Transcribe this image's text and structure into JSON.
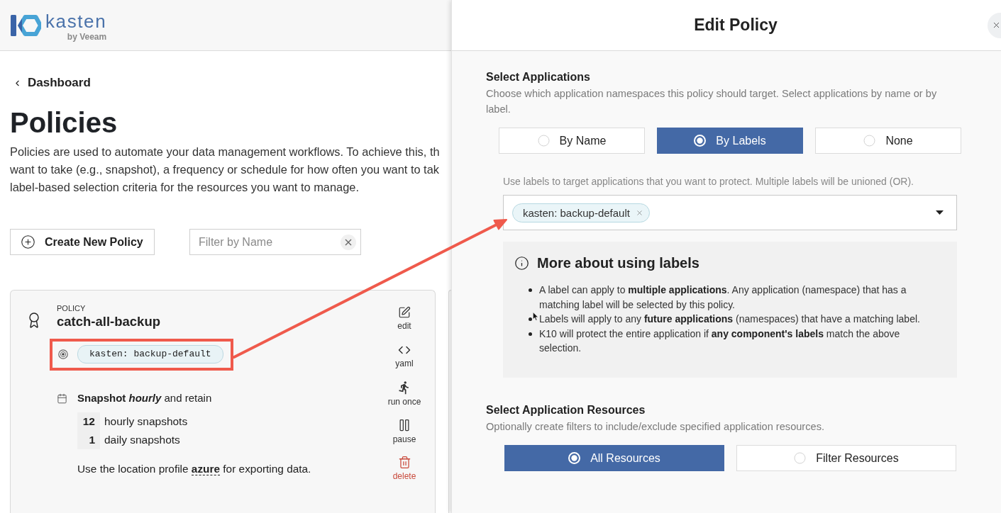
{
  "brand": {
    "name": "kasten",
    "tagline": "by Veeam"
  },
  "breadcrumb": {
    "label": "Dashboard"
  },
  "page": {
    "title": "Policies",
    "description_lines": [
      "Policies are used to automate your data management workflows. To achieve this, th",
      "want to take (e.g., snapshot), a frequency or schedule for how often you want to tak",
      "label-based selection criteria for the resources you want to manage."
    ]
  },
  "toolbar": {
    "create_button": "Create New Policy",
    "filter": {
      "placeholder": "Filter by Name"
    }
  },
  "policy_card": {
    "eyebrow": "POLICY",
    "name": "catch-all-backup",
    "labels": [
      "kasten: backup-default"
    ],
    "schedule": {
      "action": "Snapshot",
      "frequency": "hourly",
      "suffix": "and retain"
    },
    "retention": [
      {
        "count": "12",
        "unit": "hourly snapshots"
      },
      {
        "count": "1",
        "unit": "daily snapshots"
      }
    ],
    "location_note": "Use the location profile **azure** for exporting data.",
    "actions": [
      {
        "kind": "edit",
        "label": "edit"
      },
      {
        "kind": "yaml",
        "label": "yaml"
      },
      {
        "kind": "run",
        "label": "run once"
      },
      {
        "kind": "pause",
        "label": "pause"
      },
      {
        "kind": "delete",
        "label": "delete"
      }
    ]
  },
  "edit_panel": {
    "title": "Edit Policy",
    "application_selection": {
      "title": "Select Applications",
      "description": "Choose which application namespaces this policy should target. Select applications by name or by label.",
      "options": [
        {
          "label": "By Name",
          "selected": false
        },
        {
          "label": "By Labels",
          "selected": true
        },
        {
          "label": "None",
          "selected": false
        }
      ],
      "hint": "Use labels to target applications that you want to protect. Multiple labels will be unioned (OR).",
      "labels_field": {
        "chips": [
          {
            "label": "kasten: backup-default"
          }
        ]
      },
      "info": {
        "title": "More about using labels",
        "items": [
          "A label can apply to **multiple applications**. Any application (namespace) that has a matching label will be selected by this policy.",
          "Labels will apply to any **future applications** (namespaces) that have a matching label.",
          "K10 will protect the entire application if **any component's labels** match the above selection."
        ]
      }
    },
    "resource_selection": {
      "title": "Select Application Resources",
      "description": "Optionally create filters to include/exclude specified application resources.",
      "options": [
        {
          "label": "All Resources",
          "selected": true
        },
        {
          "label": "Filter Resources",
          "selected": false
        }
      ]
    }
  }
}
